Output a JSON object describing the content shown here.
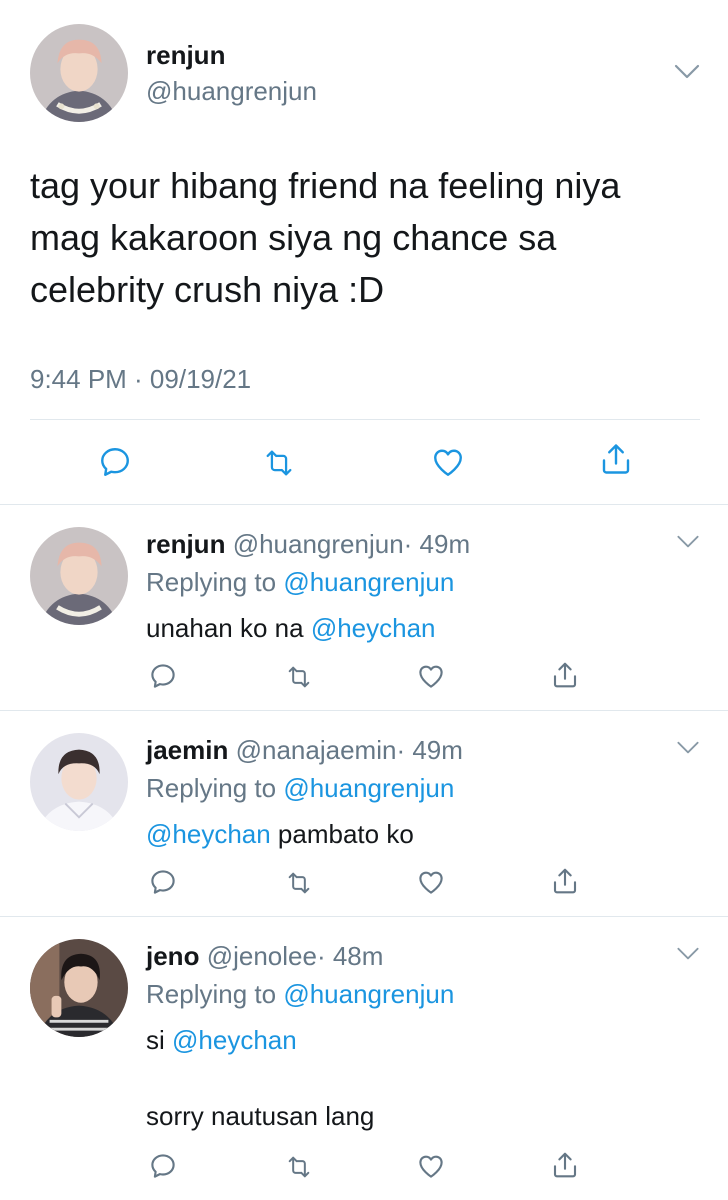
{
  "main_tweet": {
    "name": "renjun",
    "handle": "@huangrenjun",
    "text": "tag your hibang friend na feeling niya mag kakaroon siya ng chance sa celebrity crush niya :D",
    "timestamp": "9:44 PM · 09/19/21"
  },
  "replies": [
    {
      "name": "renjun",
      "handle": "@huangrenjun",
      "time": "· 49m",
      "replying_prefix": "Replying to ",
      "replying_to": "@huangrenjun",
      "body_before": "unahan ko na ",
      "body_mention": "@heychan",
      "body_after": "",
      "body_line2": ""
    },
    {
      "name": "jaemin",
      "handle": "@nanajaemin",
      "time": "· 49m",
      "replying_prefix": "Replying to ",
      "replying_to": "@huangrenjun",
      "body_before": "",
      "body_mention": "@heychan",
      "body_after": " pambato ko",
      "body_line2": ""
    },
    {
      "name": "jeno",
      "handle": "@jenolee",
      "time": "· 48m",
      "replying_prefix": "Replying to ",
      "replying_to": "@huangrenjun",
      "body_before": "si ",
      "body_mention": "@heychan",
      "body_after": "",
      "body_line2": "sorry nautusan lang"
    }
  ],
  "icons": [
    "reply-icon",
    "retweet-icon",
    "like-icon",
    "share-icon",
    "chevron-down-icon"
  ],
  "colors": {
    "text": "#14171a",
    "secondary": "#657786",
    "link": "#1b95e0",
    "border": "#e1e8ed"
  }
}
